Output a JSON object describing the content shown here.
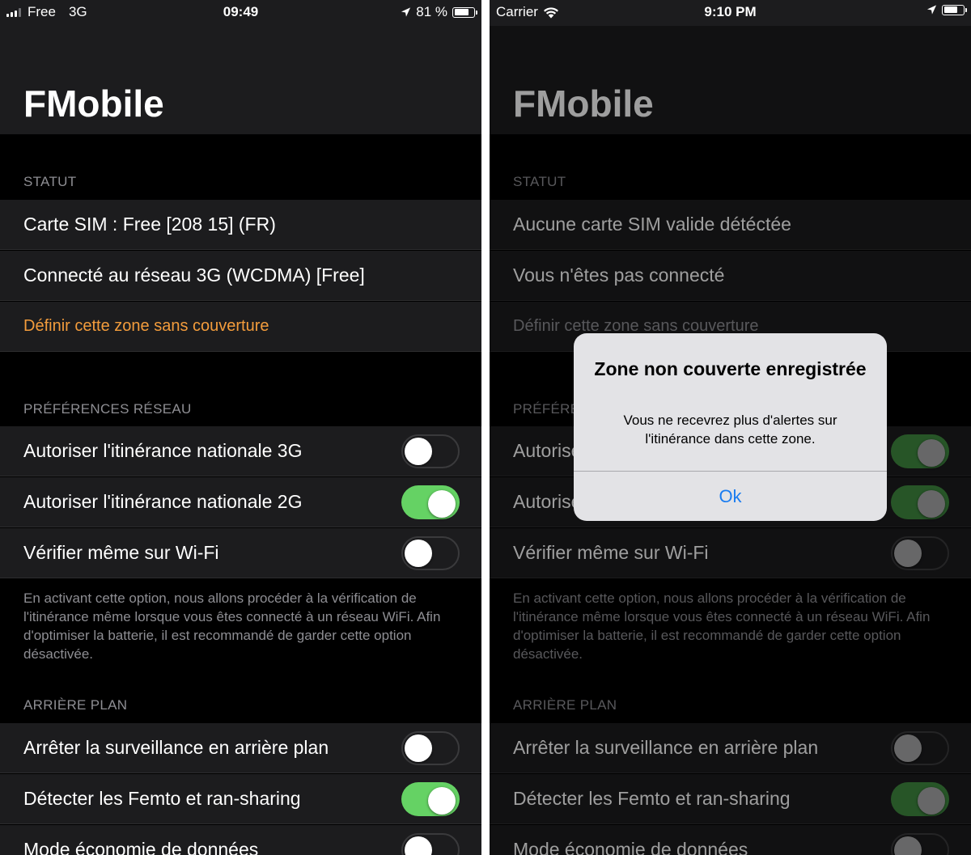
{
  "colors": {
    "accent": "#f39c3c",
    "toggle_on": "#65d264",
    "alert_button": "#1a7cf0",
    "background": "#000000",
    "row_background": "#1c1c1e",
    "header_text": "#8e8e93"
  },
  "left": {
    "status_bar": {
      "carrier": "Free",
      "network": "3G",
      "time": "09:49",
      "battery": "81 %",
      "battery_level": 0.81
    },
    "title": "FMobile",
    "statut": {
      "header": "STATUT",
      "sim": "Carte SIM : Free [208 15] (FR)",
      "network": "Connecté au réseau 3G (WCDMA) [Free]",
      "define_zone": "Définir cette zone sans couverture"
    },
    "network_prefs": {
      "header": "PRÉFÉRENCES RÉSEAU",
      "items": [
        {
          "label": "Autoriser l'itinérance nationale 3G",
          "on": false
        },
        {
          "label": "Autoriser l'itinérance nationale 2G",
          "on": true
        },
        {
          "label": "Vérifier même sur Wi-Fi",
          "on": false
        }
      ],
      "footnote": "En activant cette option, nous allons procéder à la vérification de l'itinérance même lorsque vous êtes connecté à un réseau WiFi. Afin d'optimiser la batterie, il est recommandé de garder cette option désactivée."
    },
    "background": {
      "header": "ARRIÈRE PLAN",
      "items": [
        {
          "label": "Arrêter la surveillance en arrière plan",
          "on": false
        },
        {
          "label": "Détecter les Femto et ran-sharing",
          "on": true
        },
        {
          "label": "Mode économie de données",
          "on": false
        }
      ]
    }
  },
  "right": {
    "status_bar": {
      "carrier": "Carrier",
      "time": "9:10 PM",
      "battery_level": 0.75
    },
    "title": "FMobile",
    "statut": {
      "header": "STATUT",
      "sim": "Aucune carte SIM valide détéctée",
      "network": "Vous n'êtes pas connecté",
      "define_zone": "Définir cette zone sans couverture"
    },
    "network_prefs": {
      "header": "PRÉFÉRENCES RÉSEAU",
      "items": [
        {
          "label": "Autoriser l'itinérance nationale 3G",
          "on": true
        },
        {
          "label": "Autoriser l'itinérance nationale 2G",
          "on": true
        },
        {
          "label": "Vérifier même sur Wi-Fi",
          "on": false
        }
      ],
      "footnote": "En activant cette option, nous allons procéder à la vérification de l'itinérance même lorsque vous êtes connecté à un réseau WiFi. Afin d'optimiser la batterie, il est recommandé de garder cette option désactivée."
    },
    "background": {
      "header": "ARRIÈRE PLAN",
      "items": [
        {
          "label": "Arrêter la surveillance en arrière plan",
          "on": false
        },
        {
          "label": "Détecter les Femto et ran-sharing",
          "on": true
        },
        {
          "label": "Mode économie de données",
          "on": false
        }
      ]
    },
    "alert": {
      "title": "Zone non couverte enregistrée",
      "message": "Vous ne recevrez plus d'alertes sur l'itinérance dans cette zone.",
      "button": "Ok"
    }
  }
}
